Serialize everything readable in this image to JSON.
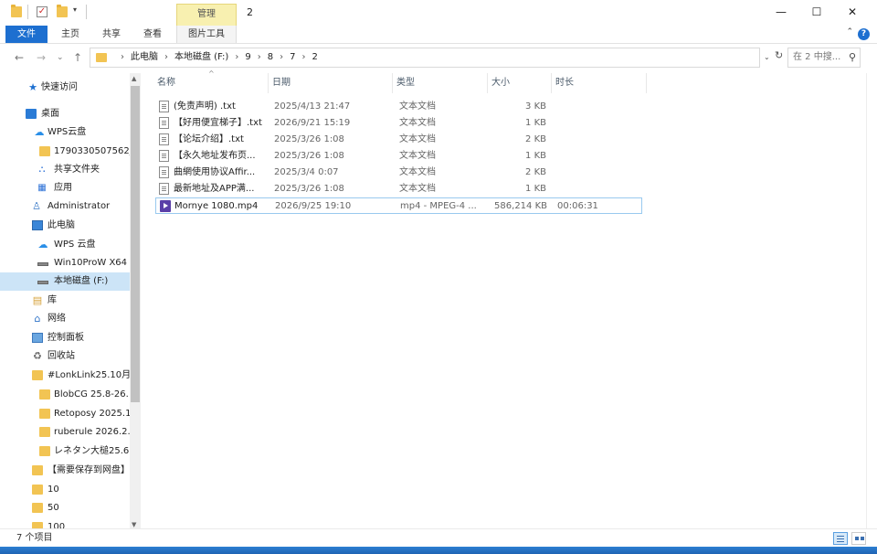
{
  "window": {
    "title": "2",
    "manage_tab": "管理",
    "minimize": "—",
    "maximize": "☐",
    "close": "✕"
  },
  "ribbon": {
    "tabs": [
      {
        "label": "文件"
      },
      {
        "label": "主页"
      },
      {
        "label": "共享"
      },
      {
        "label": "查看"
      },
      {
        "label": "图片工具"
      }
    ],
    "help": "?",
    "expand": "⌃"
  },
  "nav_buttons": {
    "back": "←",
    "forward": "→",
    "recent": "⌄",
    "up": "↑"
  },
  "address": {
    "crumbs": [
      "此电脑",
      "本地磁盘 (F:)",
      "9",
      "8",
      "7",
      "2"
    ],
    "dropdown": "⌄",
    "refresh": "↻"
  },
  "search": {
    "placeholder": "在 2 中搜...",
    "icon": "search-icon"
  },
  "nav_pane": {
    "items": [
      {
        "label": "快速访问",
        "icon": "star-icon",
        "glyph": "★"
      },
      {
        "label": "桌面",
        "icon": "desktop-icon",
        "glyph": ""
      },
      {
        "label": "WPS云盘",
        "icon": "cloud-icon",
        "glyph": "☁"
      },
      {
        "label": "1790330507562_",
        "icon": "folder-icon",
        "glyph": ""
      },
      {
        "label": "共享文件夹",
        "icon": "share-icon",
        "glyph": "⛬"
      },
      {
        "label": "应用",
        "icon": "apps-icon",
        "glyph": "▦"
      },
      {
        "label": "Administrator",
        "icon": "user-icon",
        "glyph": "👤"
      },
      {
        "label": "此电脑",
        "icon": "computer-icon",
        "glyph": ""
      },
      {
        "label": "WPS 云盘",
        "icon": "cloud-icon",
        "glyph": "☁"
      },
      {
        "label": "Win10ProW X64",
        "icon": "drive-icon",
        "glyph": ""
      },
      {
        "label": "本地磁盘 (F:)",
        "icon": "drive-icon",
        "glyph": "",
        "selected": true
      },
      {
        "label": "库",
        "icon": "library-icon",
        "glyph": "▤"
      },
      {
        "label": "网络",
        "icon": "network-icon",
        "glyph": "⌂"
      },
      {
        "label": "控制面板",
        "icon": "control-panel-icon",
        "glyph": ""
      },
      {
        "label": "回收站",
        "icon": "recycle-bin-icon",
        "glyph": "♻"
      },
      {
        "label": "#LonkLink25.10月",
        "icon": "folder-icon",
        "glyph": ""
      },
      {
        "label": "BlobCG 25.8-26.",
        "icon": "folder-icon",
        "glyph": ""
      },
      {
        "label": "Retoposy 2025.1",
        "icon": "folder-icon",
        "glyph": ""
      },
      {
        "label": "ruberule 2026.2.",
        "icon": "folder-icon",
        "glyph": ""
      },
      {
        "label": "レネタン大槌25.6",
        "icon": "folder-icon",
        "glyph": ""
      },
      {
        "label": "【需要保存到网盘】",
        "icon": "folder-icon",
        "glyph": ""
      },
      {
        "label": "10",
        "icon": "folder-icon",
        "glyph": ""
      },
      {
        "label": "50",
        "icon": "folder-icon",
        "glyph": ""
      },
      {
        "label": "100",
        "icon": "folder-icon",
        "glyph": ""
      }
    ]
  },
  "columns": {
    "name": "名称",
    "date": "日期",
    "type": "类型",
    "size": "大小",
    "duration": "时长",
    "sort": "^"
  },
  "files": [
    {
      "name": "(免责声明) .txt",
      "date": "2025/4/13 21:47",
      "type": "文本文档",
      "size": "3 KB",
      "duration": "",
      "kind": "txt"
    },
    {
      "name": "【好用便宜梯子】.txt",
      "date": "2026/9/21 15:19",
      "type": "文本文档",
      "size": "1 KB",
      "duration": "",
      "kind": "txt"
    },
    {
      "name": "【论坛介绍】.txt",
      "date": "2025/3/26 1:08",
      "type": "文本文档",
      "size": "2 KB",
      "duration": "",
      "kind": "txt"
    },
    {
      "name": "【永久地址发布页...",
      "date": "2025/3/26 1:08",
      "type": "文本文档",
      "size": "1 KB",
      "duration": "",
      "kind": "txt"
    },
    {
      "name": "曲網使用协议Affir...",
      "date": "2025/3/4 0:07",
      "type": "文本文档",
      "size": "2 KB",
      "duration": "",
      "kind": "txt"
    },
    {
      "name": "最新地址及APP满...",
      "date": "2025/3/26 1:08",
      "type": "文本文档",
      "size": "1 KB",
      "duration": "",
      "kind": "txt"
    },
    {
      "name": "Mornye 1080.mp4",
      "date": "2026/9/25 19:10",
      "type": "mp4 - MPEG-4 ...",
      "size": "586,214 KB",
      "duration": "00:06:31",
      "kind": "video",
      "selected": true
    }
  ],
  "status": {
    "count": "7 个项目"
  },
  "colors": {
    "accent": "#1d6fd0",
    "selection": "#cce4f7",
    "manage_tab": "#f8f0b0"
  }
}
